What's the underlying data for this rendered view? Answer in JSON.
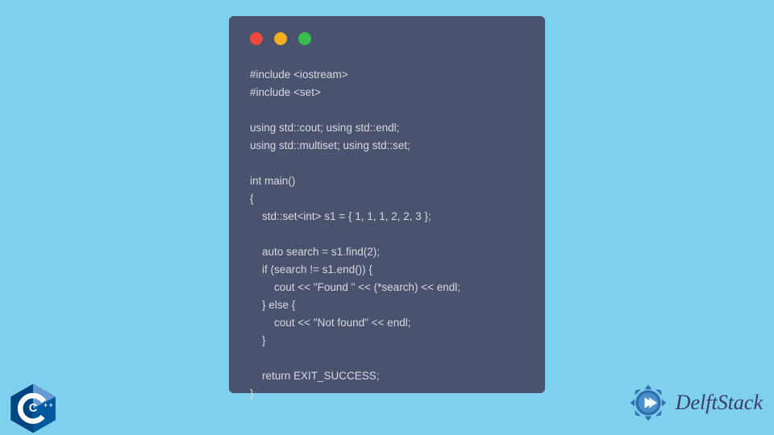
{
  "window": {
    "dots": {
      "red": "#e94b3c",
      "yellow": "#f2b022",
      "green": "#37be4d"
    }
  },
  "code_lines": [
    "#include <iostream>",
    "#include <set>",
    "",
    "using std::cout; using std::endl;",
    "using std::multiset; using std::set;",
    "",
    "int main()",
    "{",
    "    std::set<int> s1 = { 1, 1, 1, 2, 2, 3 };",
    "",
    "    auto search = s1.find(2);",
    "    if (search != s1.end()) {",
    "        cout << \"Found \" << (*search) << endl;",
    "    } else {",
    "        cout << \"Not found\" << endl;",
    "    }",
    "",
    "    return EXIT_SUCCESS;",
    "}"
  ],
  "cpp_badge": {
    "label": "C++",
    "color": "#004482",
    "accent": "#659ad2"
  },
  "delft": {
    "text": "DelftStack",
    "icon_color": "#2f6fb0"
  }
}
